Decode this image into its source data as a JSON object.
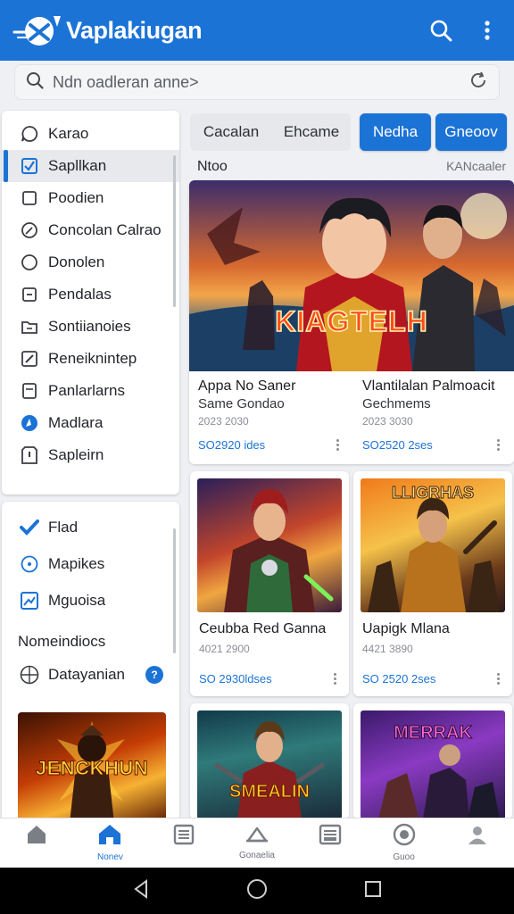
{
  "app": {
    "title": "Vaplakiugan",
    "accent": "#1c73d6"
  },
  "search": {
    "placeholder": "Ndn oadleran anne>"
  },
  "sidebar": {
    "items": [
      {
        "label": "Karao",
        "icon": "chat-icon"
      },
      {
        "label": "Sapllkan",
        "icon": "checkbox-icon",
        "active": true
      },
      {
        "label": "Poodien",
        "icon": "square-icon"
      },
      {
        "label": "Concolan Calrao",
        "icon": "compass-icon"
      },
      {
        "label": "Donolen",
        "icon": "circle-icon"
      },
      {
        "label": "Pendalas",
        "icon": "minus-square-icon"
      },
      {
        "label": "Sontiianoies",
        "icon": "folder-icon"
      },
      {
        "label": "Reneiknintep",
        "icon": "edit-icon"
      },
      {
        "label": "Panlarlarns",
        "icon": "document-icon"
      },
      {
        "label": "Madlara",
        "icon": "navigation-icon"
      },
      {
        "label": "Sapleirn",
        "icon": "info-icon"
      }
    ],
    "secondary": [
      {
        "label": "Flad",
        "icon": "check-mark-icon"
      },
      {
        "label": "Mapikes",
        "icon": "target-icon"
      },
      {
        "label": "Mguoisa",
        "icon": "chart-icon"
      }
    ],
    "heading": "Nomeindiocs",
    "extra": {
      "label": "Datayanian",
      "badge": "?",
      "icon": "globe-icon"
    },
    "banner_text": "JENCKHUN"
  },
  "tabs": {
    "items": [
      "Cacalan",
      "Ehcame",
      "Nedha",
      "Gneoov"
    ]
  },
  "section": {
    "title": "Ntoo",
    "more": "KANcaaler"
  },
  "cards": [
    {
      "art_text": "KIAGTELH",
      "title": "Appa No Saner",
      "subtitle": "Same Gondao",
      "date": "2023 2030",
      "size": "SO2920 ides"
    },
    {
      "title": "Vlantilalan Palmoacit",
      "subtitle": "Gechmems",
      "date": "2023 3030",
      "size": "SO2520 2ses"
    },
    {
      "title": "Ceubba Red Ganna",
      "date": "4021 2900",
      "size": "SO 2930ldses"
    },
    {
      "art_text": "LLIGRHAS",
      "title": "Uapigk Mlana",
      "date": "4421 3890",
      "size": "SO 2520 2ses"
    },
    {
      "art_text": "SMEALIN"
    },
    {
      "art_text": "MERRAK"
    }
  ],
  "bottom_nav": [
    {
      "label": "",
      "icon": "home-icon"
    },
    {
      "label": "Nonev",
      "icon": "home-filled-icon",
      "active": true
    },
    {
      "label": "",
      "icon": "list-icon"
    },
    {
      "label": "Gonaelia",
      "icon": "cloud-icon"
    },
    {
      "label": "",
      "icon": "image-icon"
    },
    {
      "label": "Guoo",
      "icon": "record-icon"
    },
    {
      "label": "",
      "icon": "user-icon"
    }
  ]
}
